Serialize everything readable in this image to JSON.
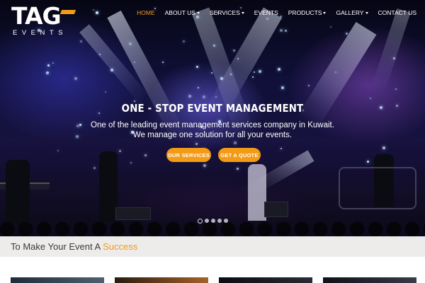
{
  "logo": {
    "mark": "TAG",
    "subtitle": "EVENTS"
  },
  "nav": {
    "items": [
      {
        "label": "HOME",
        "dropdown": false,
        "active": true
      },
      {
        "label": "ABOUT US",
        "dropdown": true,
        "active": false
      },
      {
        "label": "SERVICES",
        "dropdown": true,
        "active": false
      },
      {
        "label": "EVENTS",
        "dropdown": false,
        "active": false
      },
      {
        "label": "PRODUCTS",
        "dropdown": true,
        "active": false
      },
      {
        "label": "GALLERY",
        "dropdown": true,
        "active": false
      },
      {
        "label": "CONTACT US",
        "dropdown": false,
        "active": false
      }
    ]
  },
  "hero": {
    "title": "ONE - STOP EVENT MANAGEMENT",
    "line1": "One of the leading event management services company in Kuwait.",
    "line2": "We manage one solution for all your events.",
    "button_services": "OUR SERVICES",
    "button_quote": "GET A QUOTE",
    "slides_total": 5,
    "slide_active": 1
  },
  "section": {
    "title_prefix": "To Make Your Event A ",
    "title_highlight": "Success"
  },
  "colors": {
    "accent": "#f39a16",
    "nav_text": "#ffffff",
    "section_bg": "#eeeceb",
    "section_text": "#3b3b3b"
  }
}
